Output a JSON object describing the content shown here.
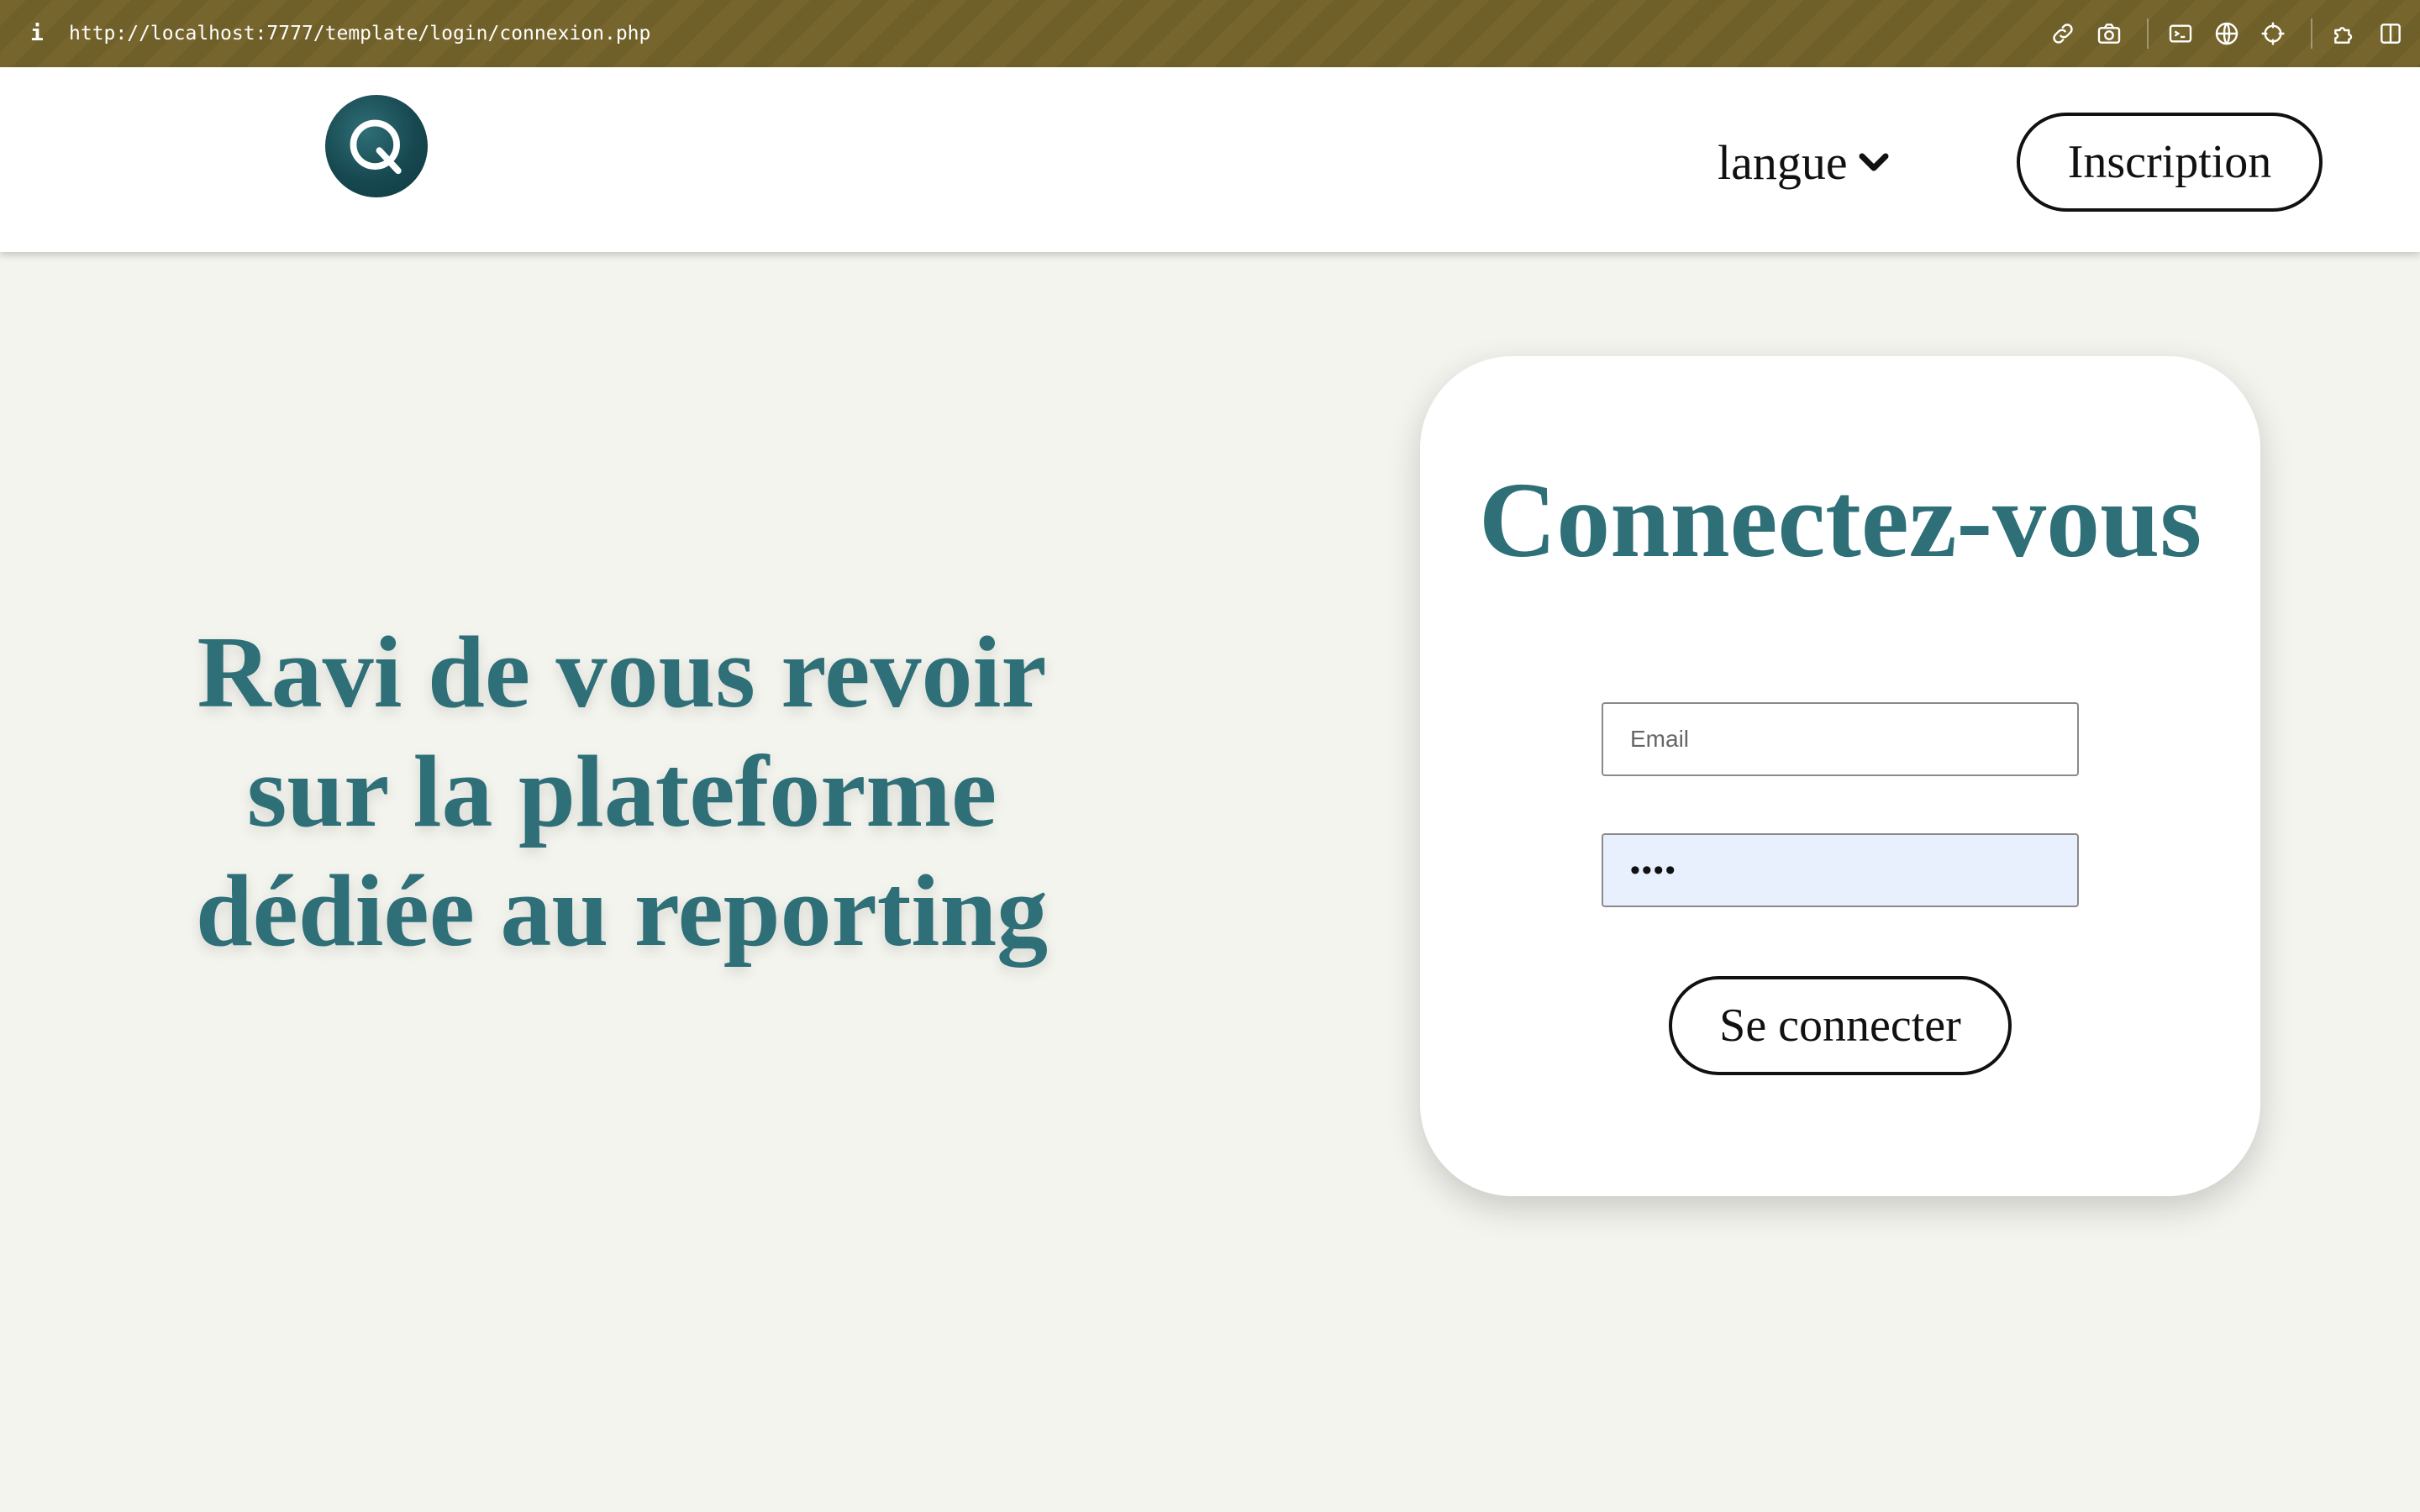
{
  "browser": {
    "info_icon": "info-icon",
    "url": "http://localhost:7777/template/login/connexion.php",
    "toolbar_icons": [
      "link-icon",
      "camera-icon",
      "terminal-icon",
      "globe-icon",
      "crosshair-icon",
      "extension-icon",
      "sidebar-icon"
    ]
  },
  "header": {
    "logo": "q-logo-icon",
    "language_label": "langue",
    "language_icon": "chevron-down-icon",
    "register_label": "Inscription"
  },
  "hero": {
    "line1": "Ravi de vous revoir",
    "line2": "sur la plateforme",
    "line3": "dédiée au reporting"
  },
  "login": {
    "title": "Connectez-vous",
    "email_placeholder": "Email",
    "email_value": "",
    "password_value": "••••",
    "submit_label": "Se connecter"
  },
  "colors": {
    "accent": "#2e6f78",
    "chrome": "#76652c",
    "background": "#f4f4ef"
  }
}
